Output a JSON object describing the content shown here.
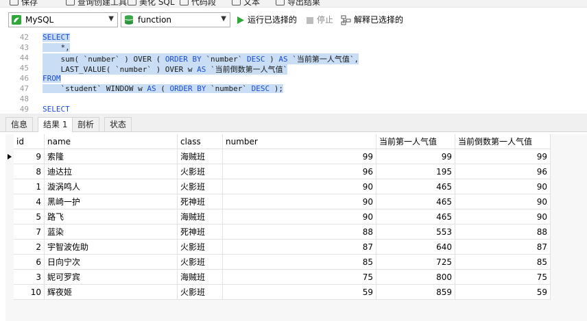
{
  "menu": {
    "items": [
      "保存",
      "查询创建工具",
      "美化 SQL",
      "代码段",
      "文本",
      "导出结果"
    ]
  },
  "toolbar": {
    "connection": "MySQL",
    "database": "function",
    "run_label": "运行已选择的",
    "stop_label": "停止",
    "explain_label": "解释已选择的"
  },
  "editor": {
    "line_numbers": [
      "42",
      "43",
      "44",
      "45",
      "46",
      "47",
      "48",
      "49"
    ],
    "lines": [
      [
        "SELECT"
      ],
      [
        "    *,"
      ],
      [
        "    sum( `number` ) OVER ( ",
        "ORDER BY",
        " `number` ",
        "DESC",
        " ) ",
        "AS",
        " `当前第一人气值`,"
      ],
      [
        "    LAST_VALUE( `number` ) OVER w ",
        "AS",
        " `当前倒数第一人气值`"
      ],
      [
        "FROM"
      ],
      [
        "    `student` WINDOW w ",
        "AS",
        " ( ",
        "ORDER BY",
        " `number` ",
        "DESC",
        " );"
      ],
      [
        ""
      ],
      [
        "SELECT"
      ]
    ]
  },
  "result_tabs": [
    "信息",
    "结果 1",
    "剖析",
    "状态"
  ],
  "active_tab": "结果 1",
  "table": {
    "columns": [
      "id",
      "name",
      "class",
      "number",
      "当前第一人气值",
      "当前倒数第一人气值"
    ],
    "rows": [
      [
        "9",
        "索隆",
        "海贼班",
        "99",
        "99",
        "99"
      ],
      [
        "8",
        "迪达拉",
        "火影班",
        "96",
        "195",
        "96"
      ],
      [
        "1",
        "漩涡鸣人",
        "火影班",
        "90",
        "465",
        "90"
      ],
      [
        "4",
        "黑崎一护",
        "死神班",
        "90",
        "465",
        "90"
      ],
      [
        "5",
        "路飞",
        "海贼班",
        "90",
        "465",
        "90"
      ],
      [
        "7",
        "蓝染",
        "死神班",
        "88",
        "553",
        "88"
      ],
      [
        "2",
        "宇智波佐助",
        "火影班",
        "87",
        "640",
        "87"
      ],
      [
        "6",
        "日向宁次",
        "火影班",
        "85",
        "725",
        "85"
      ],
      [
        "3",
        "妮可罗宾",
        "海贼班",
        "75",
        "800",
        "75"
      ],
      [
        "10",
        "辉夜姬",
        "火影班",
        "59",
        "859",
        "59"
      ]
    ]
  },
  "colors": {
    "keyword": "#1a4bd6",
    "selection": "#c9def5",
    "run_green": "#2fa83a",
    "db_green": "#3aa64a"
  }
}
